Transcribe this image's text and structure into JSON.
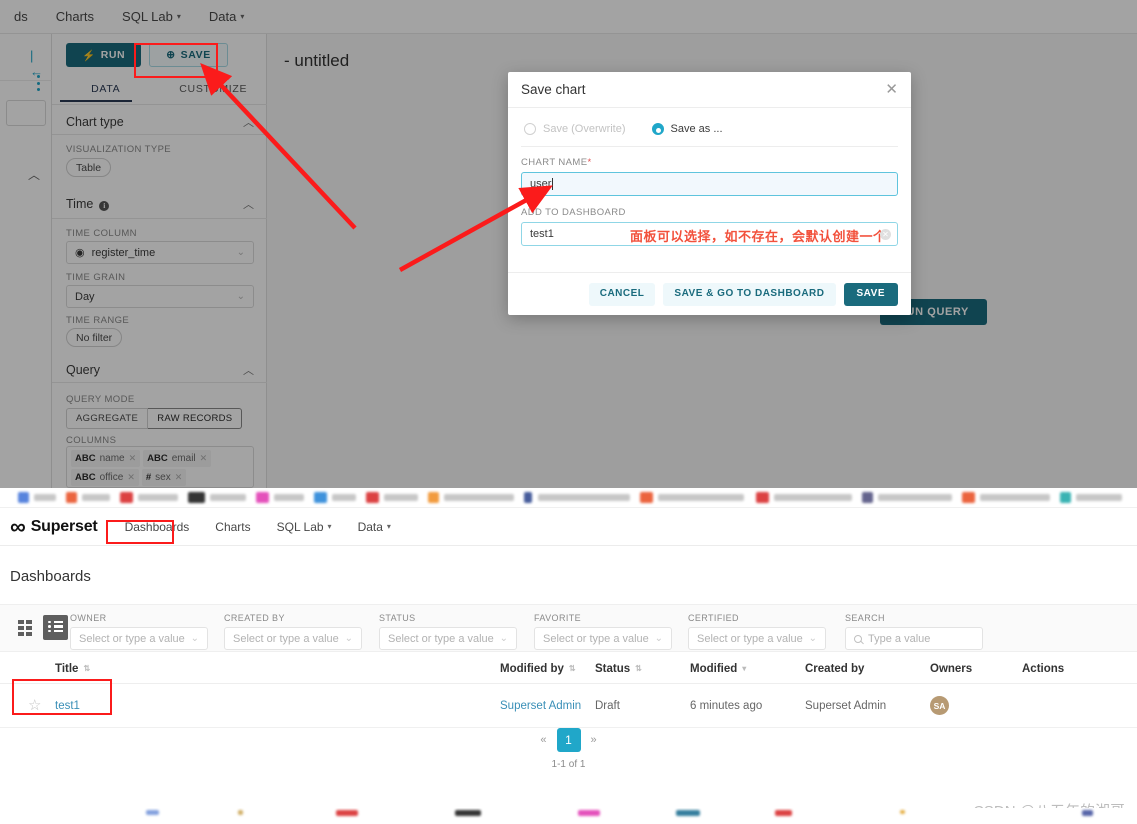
{
  "explore": {
    "nav_items": [
      {
        "label": "ds",
        "caret": false
      },
      {
        "label": "Charts",
        "caret": false
      },
      {
        "label": "SQL Lab",
        "caret": true
      },
      {
        "label": "Data",
        "caret": true
      }
    ],
    "run_button": "RUN",
    "save_button": "SAVE",
    "tabs": [
      {
        "label": "DATA",
        "active": true
      },
      {
        "label": "CUSTOMIZE",
        "active": false
      }
    ],
    "sections": {
      "chart_type": {
        "title": "Chart type",
        "viz_type_label": "VISUALIZATION TYPE",
        "viz_type_value": "Table"
      },
      "time": {
        "title": "Time",
        "time_column_label": "TIME COLUMN",
        "time_column_value": "register_time",
        "time_grain_label": "TIME GRAIN",
        "time_grain_value": "Day",
        "time_range_label": "TIME RANGE",
        "time_range_value": "No filter"
      },
      "query": {
        "title": "Query",
        "query_mode_label": "QUERY MODE",
        "query_mode_options": [
          "AGGREGATE",
          "RAW RECORDS"
        ],
        "query_mode_selected": "RAW RECORDS",
        "columns_label": "COLUMNS",
        "columns": [
          {
            "type": "ABC",
            "name": "name"
          },
          {
            "type": "ABC",
            "name": "email"
          },
          {
            "type": "ABC",
            "name": "office"
          },
          {
            "type": "#",
            "name": "sex"
          }
        ]
      }
    },
    "chart_title": "- untitled",
    "run_query_button": "RUN QUERY"
  },
  "modal": {
    "title": "Save chart",
    "close_icon": "close-icon",
    "radio_overwrite": "Save (Overwrite)",
    "radio_save_as": "Save as ...",
    "chart_name_label": "CHART NAME",
    "chart_name_required": "*",
    "chart_name_value": "user",
    "dashboard_label": "ADD TO DASHBOARD",
    "dashboard_value": "test1",
    "annotation_cn": "面板可以选择，如不存在，会默认创建一个",
    "buttons": {
      "cancel": "CANCEL",
      "save_goto": "SAVE & GO TO DASHBOARD",
      "save": "SAVE"
    }
  },
  "dashboards_page": {
    "brand": "Superset",
    "nav_items": [
      {
        "label": "Dashboards",
        "caret": false,
        "highlighted": true
      },
      {
        "label": "Charts",
        "caret": false,
        "highlighted": false
      },
      {
        "label": "SQL Lab",
        "caret": true,
        "highlighted": false
      },
      {
        "label": "Data",
        "caret": true,
        "highlighted": false
      }
    ],
    "page_title": "Dashboards",
    "filters": [
      {
        "label": "OWNER",
        "placeholder": "Select or type a value"
      },
      {
        "label": "CREATED BY",
        "placeholder": "Select or type a value"
      },
      {
        "label": "STATUS",
        "placeholder": "Select or type a value"
      },
      {
        "label": "FAVORITE",
        "placeholder": "Select or type a value"
      },
      {
        "label": "CERTIFIED",
        "placeholder": "Select or type a value"
      },
      {
        "label": "SEARCH",
        "placeholder": "Type a value"
      }
    ],
    "table": {
      "headers": [
        "Title",
        "Modified by",
        "Status",
        "Modified",
        "Created by",
        "Owners",
        "Actions"
      ],
      "rows": [
        {
          "title": "test1",
          "modified_by": "Superset Admin",
          "status": "Draft",
          "modified": "6 minutes ago",
          "created_by": "Superset Admin",
          "owner_initials": "SA",
          "actions": ""
        }
      ]
    },
    "pagination": {
      "prev": "«",
      "page": "1",
      "next": "»",
      "info": "1-1 of 1"
    },
    "watermark": "CSDN @八五年的湘哥"
  },
  "colors": {
    "annotation_red": "#fb1b1b",
    "superset_teal": "#20a7c9",
    "run_button_teal": "#1a6b7d",
    "link_blue": "#3a8fb7",
    "avatar_brown": "#b79a73",
    "cn_note_red": "#f2513c"
  }
}
